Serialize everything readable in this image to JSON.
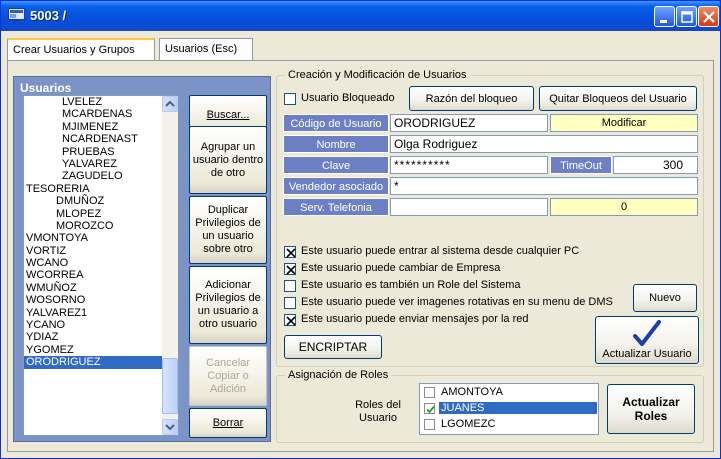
{
  "window": {
    "title": "5003 /"
  },
  "tabs": [
    {
      "label": "Crear Usuarios y Grupos"
    },
    {
      "label": "Usuarios (Esc)"
    }
  ],
  "users": {
    "header": "Usuarios",
    "items": [
      {
        "label": "LVELEZ",
        "indent": 2
      },
      {
        "label": "MCARDENAS",
        "indent": 2
      },
      {
        "label": "MJIMENEZ",
        "indent": 2
      },
      {
        "label": "NCARDENAST",
        "indent": 2
      },
      {
        "label": "PRUEBAS",
        "indent": 2
      },
      {
        "label": "YALVAREZ",
        "indent": 2
      },
      {
        "label": "ZAGUDELO",
        "indent": 2
      },
      {
        "label": "TESORERIA",
        "indent": 0
      },
      {
        "label": "DMUÑOZ",
        "indent": 1
      },
      {
        "label": "MLOPEZ",
        "indent": 1
      },
      {
        "label": "MOROZCO",
        "indent": 1
      },
      {
        "label": "VMONTOYA",
        "indent": 0
      },
      {
        "label": "VORTIZ",
        "indent": 0
      },
      {
        "label": "WCANO",
        "indent": 0
      },
      {
        "label": "WCORREA",
        "indent": 0
      },
      {
        "label": "WMUÑOZ",
        "indent": 0
      },
      {
        "label": "WOSORNO",
        "indent": 0
      },
      {
        "label": "YALVAREZ1",
        "indent": 0
      },
      {
        "label": "YCANO",
        "indent": 0
      },
      {
        "label": "YDIAZ",
        "indent": 0
      },
      {
        "label": "YGOMEZ",
        "indent": 0
      },
      {
        "label": "ORODRIGUEZ",
        "indent": 0,
        "selected": true
      }
    ],
    "buttons": {
      "buscar": "Buscar...",
      "agrupar": "Agrupar un usuario dentro de otro",
      "duplicar": "Duplicar Privilegios de un usuario sobre otro",
      "adicionar": "Adicionar Privilegios de un usuario a otro usuario",
      "cancelar": "Cancelar Copiar o Adición",
      "borrar": "Borrar"
    }
  },
  "creation": {
    "legend": "Creación y Modificación de Usuarios",
    "bloqueado_label": "Usuario Bloqueado",
    "bloqueado_checked": false,
    "razon_button": "Razón del bloqueo",
    "quitar_button": "Quitar Bloqueos del Usuario",
    "codigo": {
      "label": "Código de Usuario",
      "value": "ORODRIGUEZ"
    },
    "modificar": "Modificar",
    "nombre": {
      "label": "Nombre",
      "value": "Olga Rodriguez"
    },
    "clave": {
      "label": "Clave",
      "value": "**********"
    },
    "timeout": {
      "label": "TimeOut",
      "value": "300"
    },
    "vendedor": {
      "label": "Vendedor asociado",
      "value": "*"
    },
    "telefonia": {
      "label": "Serv. Telefonia",
      "value": "",
      "extra": "0"
    },
    "options": [
      {
        "label": "Este usuario puede entrar al sistema desde cualquier PC",
        "checked": true
      },
      {
        "label": "Este usuario puede cambiar de Empresa",
        "checked": true
      },
      {
        "label": "Este usuario es también un Role del Sistema",
        "checked": false
      },
      {
        "label": "Este usuario puede ver imagenes rotativas en su menu de DMS",
        "checked": false
      },
      {
        "label": "Este usuario puede enviar mensajes por la red",
        "checked": true
      }
    ],
    "encriptar_button": "ENCRIPTAR",
    "nuevo_button": "Nuevo",
    "actualizar_button": "Actualizar Usuario"
  },
  "roles": {
    "legend": "Asignación de Roles",
    "label": "Roles del Usuario",
    "items": [
      {
        "label": "AMONTOYA",
        "checked": false
      },
      {
        "label": "JUANES",
        "checked": true,
        "selected": true
      },
      {
        "label": "LGOMEZC",
        "checked": false
      }
    ],
    "actualizar_button": "Actualizar Roles"
  }
}
